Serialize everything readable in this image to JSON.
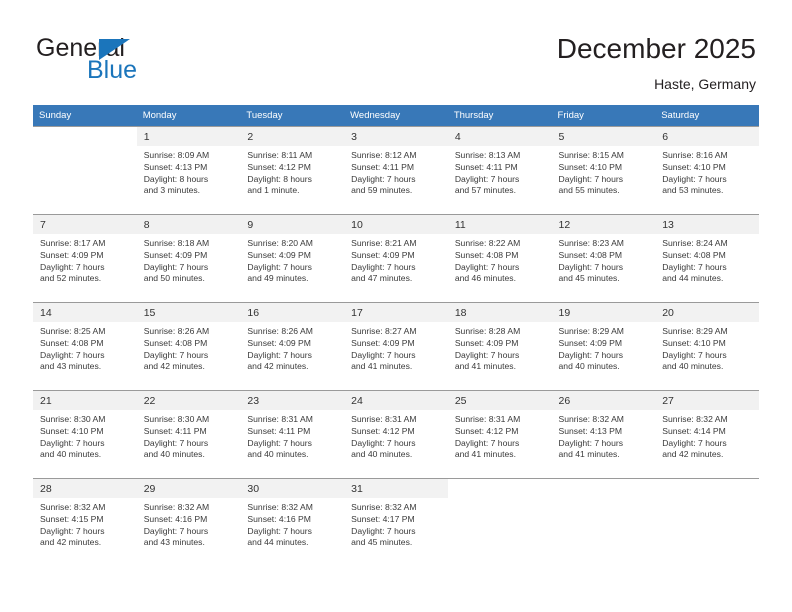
{
  "brand": {
    "name_part1": "General",
    "name_part2": "Blue",
    "flag_icon": "triangle-flag-icon",
    "color_primary": "#1b75bb",
    "color_text": "#231f20"
  },
  "header": {
    "title": "December 2025",
    "subtitle": "Haste, Germany"
  },
  "calendar": {
    "header_bg": "#3878b8",
    "header_text_color": "#ffffff",
    "weekday_headers": [
      "Sunday",
      "Monday",
      "Tuesday",
      "Wednesday",
      "Thursday",
      "Friday",
      "Saturday"
    ],
    "weeks": [
      [
        {
          "day": "",
          "sunrise": "",
          "sunset": "",
          "daylight_line1": "",
          "daylight_line2": ""
        },
        {
          "day": "1",
          "sunrise": "Sunrise: 8:09 AM",
          "sunset": "Sunset: 4:13 PM",
          "daylight_line1": "Daylight: 8 hours",
          "daylight_line2": "and 3 minutes."
        },
        {
          "day": "2",
          "sunrise": "Sunrise: 8:11 AM",
          "sunset": "Sunset: 4:12 PM",
          "daylight_line1": "Daylight: 8 hours",
          "daylight_line2": "and 1 minute."
        },
        {
          "day": "3",
          "sunrise": "Sunrise: 8:12 AM",
          "sunset": "Sunset: 4:11 PM",
          "daylight_line1": "Daylight: 7 hours",
          "daylight_line2": "and 59 minutes."
        },
        {
          "day": "4",
          "sunrise": "Sunrise: 8:13 AM",
          "sunset": "Sunset: 4:11 PM",
          "daylight_line1": "Daylight: 7 hours",
          "daylight_line2": "and 57 minutes."
        },
        {
          "day": "5",
          "sunrise": "Sunrise: 8:15 AM",
          "sunset": "Sunset: 4:10 PM",
          "daylight_line1": "Daylight: 7 hours",
          "daylight_line2": "and 55 minutes."
        },
        {
          "day": "6",
          "sunrise": "Sunrise: 8:16 AM",
          "sunset": "Sunset: 4:10 PM",
          "daylight_line1": "Daylight: 7 hours",
          "daylight_line2": "and 53 minutes."
        }
      ],
      [
        {
          "day": "7",
          "sunrise": "Sunrise: 8:17 AM",
          "sunset": "Sunset: 4:09 PM",
          "daylight_line1": "Daylight: 7 hours",
          "daylight_line2": "and 52 minutes."
        },
        {
          "day": "8",
          "sunrise": "Sunrise: 8:18 AM",
          "sunset": "Sunset: 4:09 PM",
          "daylight_line1": "Daylight: 7 hours",
          "daylight_line2": "and 50 minutes."
        },
        {
          "day": "9",
          "sunrise": "Sunrise: 8:20 AM",
          "sunset": "Sunset: 4:09 PM",
          "daylight_line1": "Daylight: 7 hours",
          "daylight_line2": "and 49 minutes."
        },
        {
          "day": "10",
          "sunrise": "Sunrise: 8:21 AM",
          "sunset": "Sunset: 4:09 PM",
          "daylight_line1": "Daylight: 7 hours",
          "daylight_line2": "and 47 minutes."
        },
        {
          "day": "11",
          "sunrise": "Sunrise: 8:22 AM",
          "sunset": "Sunset: 4:08 PM",
          "daylight_line1": "Daylight: 7 hours",
          "daylight_line2": "and 46 minutes."
        },
        {
          "day": "12",
          "sunrise": "Sunrise: 8:23 AM",
          "sunset": "Sunset: 4:08 PM",
          "daylight_line1": "Daylight: 7 hours",
          "daylight_line2": "and 45 minutes."
        },
        {
          "day": "13",
          "sunrise": "Sunrise: 8:24 AM",
          "sunset": "Sunset: 4:08 PM",
          "daylight_line1": "Daylight: 7 hours",
          "daylight_line2": "and 44 minutes."
        }
      ],
      [
        {
          "day": "14",
          "sunrise": "Sunrise: 8:25 AM",
          "sunset": "Sunset: 4:08 PM",
          "daylight_line1": "Daylight: 7 hours",
          "daylight_line2": "and 43 minutes."
        },
        {
          "day": "15",
          "sunrise": "Sunrise: 8:26 AM",
          "sunset": "Sunset: 4:08 PM",
          "daylight_line1": "Daylight: 7 hours",
          "daylight_line2": "and 42 minutes."
        },
        {
          "day": "16",
          "sunrise": "Sunrise: 8:26 AM",
          "sunset": "Sunset: 4:09 PM",
          "daylight_line1": "Daylight: 7 hours",
          "daylight_line2": "and 42 minutes."
        },
        {
          "day": "17",
          "sunrise": "Sunrise: 8:27 AM",
          "sunset": "Sunset: 4:09 PM",
          "daylight_line1": "Daylight: 7 hours",
          "daylight_line2": "and 41 minutes."
        },
        {
          "day": "18",
          "sunrise": "Sunrise: 8:28 AM",
          "sunset": "Sunset: 4:09 PM",
          "daylight_line1": "Daylight: 7 hours",
          "daylight_line2": "and 41 minutes."
        },
        {
          "day": "19",
          "sunrise": "Sunrise: 8:29 AM",
          "sunset": "Sunset: 4:09 PM",
          "daylight_line1": "Daylight: 7 hours",
          "daylight_line2": "and 40 minutes."
        },
        {
          "day": "20",
          "sunrise": "Sunrise: 8:29 AM",
          "sunset": "Sunset: 4:10 PM",
          "daylight_line1": "Daylight: 7 hours",
          "daylight_line2": "and 40 minutes."
        }
      ],
      [
        {
          "day": "21",
          "sunrise": "Sunrise: 8:30 AM",
          "sunset": "Sunset: 4:10 PM",
          "daylight_line1": "Daylight: 7 hours",
          "daylight_line2": "and 40 minutes."
        },
        {
          "day": "22",
          "sunrise": "Sunrise: 8:30 AM",
          "sunset": "Sunset: 4:11 PM",
          "daylight_line1": "Daylight: 7 hours",
          "daylight_line2": "and 40 minutes."
        },
        {
          "day": "23",
          "sunrise": "Sunrise: 8:31 AM",
          "sunset": "Sunset: 4:11 PM",
          "daylight_line1": "Daylight: 7 hours",
          "daylight_line2": "and 40 minutes."
        },
        {
          "day": "24",
          "sunrise": "Sunrise: 8:31 AM",
          "sunset": "Sunset: 4:12 PM",
          "daylight_line1": "Daylight: 7 hours",
          "daylight_line2": "and 40 minutes."
        },
        {
          "day": "25",
          "sunrise": "Sunrise: 8:31 AM",
          "sunset": "Sunset: 4:12 PM",
          "daylight_line1": "Daylight: 7 hours",
          "daylight_line2": "and 41 minutes."
        },
        {
          "day": "26",
          "sunrise": "Sunrise: 8:32 AM",
          "sunset": "Sunset: 4:13 PM",
          "daylight_line1": "Daylight: 7 hours",
          "daylight_line2": "and 41 minutes."
        },
        {
          "day": "27",
          "sunrise": "Sunrise: 8:32 AM",
          "sunset": "Sunset: 4:14 PM",
          "daylight_line1": "Daylight: 7 hours",
          "daylight_line2": "and 42 minutes."
        }
      ],
      [
        {
          "day": "28",
          "sunrise": "Sunrise: 8:32 AM",
          "sunset": "Sunset: 4:15 PM",
          "daylight_line1": "Daylight: 7 hours",
          "daylight_line2": "and 42 minutes."
        },
        {
          "day": "29",
          "sunrise": "Sunrise: 8:32 AM",
          "sunset": "Sunset: 4:16 PM",
          "daylight_line1": "Daylight: 7 hours",
          "daylight_line2": "and 43 minutes."
        },
        {
          "day": "30",
          "sunrise": "Sunrise: 8:32 AM",
          "sunset": "Sunset: 4:16 PM",
          "daylight_line1": "Daylight: 7 hours",
          "daylight_line2": "and 44 minutes."
        },
        {
          "day": "31",
          "sunrise": "Sunrise: 8:32 AM",
          "sunset": "Sunset: 4:17 PM",
          "daylight_line1": "Daylight: 7 hours",
          "daylight_line2": "and 45 minutes."
        },
        {
          "day": "",
          "sunrise": "",
          "sunset": "",
          "daylight_line1": "",
          "daylight_line2": ""
        },
        {
          "day": "",
          "sunrise": "",
          "sunset": "",
          "daylight_line1": "",
          "daylight_line2": ""
        },
        {
          "day": "",
          "sunrise": "",
          "sunset": "",
          "daylight_line1": "",
          "daylight_line2": ""
        }
      ]
    ]
  }
}
